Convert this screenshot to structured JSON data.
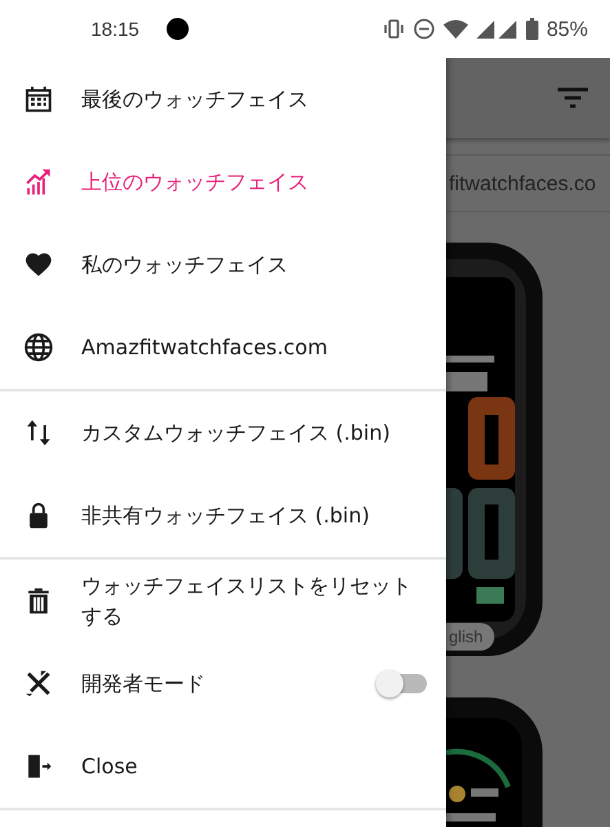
{
  "status_bar": {
    "time": "18:15",
    "battery": "85%"
  },
  "background": {
    "url_text": "fitwatchfaces.co",
    "chip": "glish"
  },
  "drawer": {
    "sections": [
      {
        "items": [
          {
            "kind": "link",
            "label": "最後のウォッチフェイス",
            "selected": false
          },
          {
            "kind": "link",
            "label": "上位のウォッチフェイス",
            "selected": true
          },
          {
            "kind": "link",
            "label": "私のウォッチフェイス",
            "selected": false
          },
          {
            "kind": "link",
            "label": "Amazfitwatchfaces.com",
            "selected": false
          }
        ]
      },
      {
        "items": [
          {
            "kind": "link",
            "label": "カスタムウォッチフェイス (.bin)",
            "selected": false
          },
          {
            "kind": "link",
            "label": "非共有ウォッチフェイス (.bin)",
            "selected": false
          }
        ]
      },
      {
        "items": [
          {
            "kind": "link",
            "label": "ウォッチフェイスリストをリセットする",
            "selected": false
          },
          {
            "kind": "toggle",
            "label": "開発者モード",
            "on": false
          },
          {
            "kind": "link",
            "label": "Close",
            "selected": false
          }
        ]
      }
    ]
  }
}
